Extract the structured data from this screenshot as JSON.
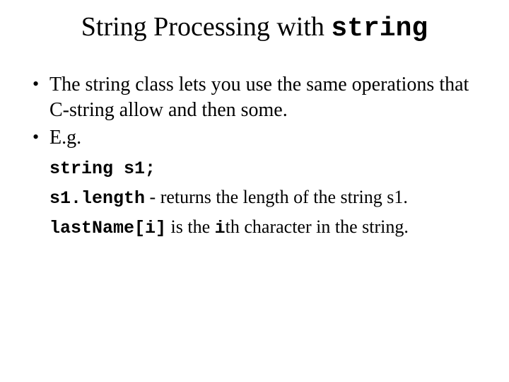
{
  "title": {
    "prefix": "String Processing with ",
    "code": "string"
  },
  "bullets": [
    "The string class lets you use the same operations that C-string allow and then some.",
    "E.g."
  ],
  "sub": {
    "line1_code": "string s1;",
    "line2_code": "s1.length",
    "line2_text": " - returns the length of the string s1.",
    "line3_code": "lastName[i]",
    "line3_text_a": " is the ",
    "line3_code2": "i",
    "line3_text_b": "th character in the string."
  }
}
